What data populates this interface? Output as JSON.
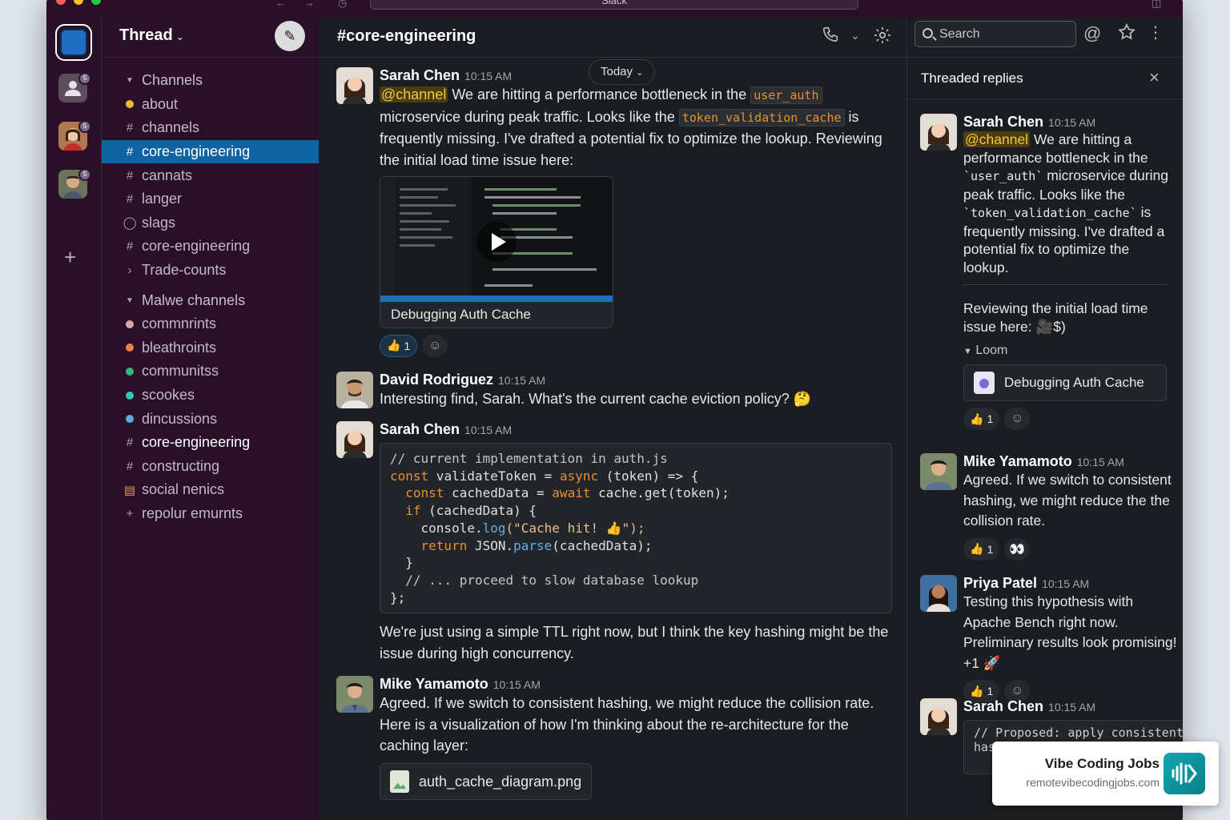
{
  "window": {
    "title": "Slack",
    "traffic_colors": [
      "#ff5f57",
      "#febc2e",
      "#28c840"
    ]
  },
  "rail": {
    "badges": [
      "5",
      "5",
      "5"
    ],
    "add_label": "+"
  },
  "sidebar": {
    "title": "Thread",
    "items": [
      {
        "label": "Channels",
        "type": "section"
      },
      {
        "label": "about",
        "type": "dot",
        "color": "#f2b534"
      },
      {
        "label": "channels",
        "type": "hash"
      },
      {
        "label": "core-engineering",
        "type": "hash",
        "active": true
      },
      {
        "label": "cannats",
        "type": "hash"
      },
      {
        "label": "langer",
        "type": "hash"
      },
      {
        "label": "slags",
        "type": "tag"
      },
      {
        "label": "core-engineering",
        "type": "hash"
      },
      {
        "label": "Trade-counts",
        "type": "chevron"
      }
    ],
    "items2": [
      {
        "label": "Malwe channels",
        "type": "section"
      },
      {
        "label": "commnrints",
        "type": "dot",
        "color": "#d9a6a6"
      },
      {
        "label": "bleathroints",
        "type": "dot",
        "color": "#e8834a"
      },
      {
        "label": "communitss",
        "type": "dot",
        "color": "#2eb67d"
      },
      {
        "label": "scookes",
        "type": "dot",
        "color": "#36c5b0"
      },
      {
        "label": "dincussions",
        "type": "dot",
        "color": "#5fa8e0"
      },
      {
        "label": "core-engineering",
        "type": "hash",
        "bright": true
      },
      {
        "label": "constructing",
        "type": "hash"
      },
      {
        "label": "social nenics",
        "type": "list"
      },
      {
        "label": "repolur emurnts",
        "type": "plus"
      }
    ]
  },
  "main": {
    "channel_title": "#core-engineering",
    "today_label": "Today",
    "messages": {
      "m1": {
        "name": "Sarah Chen",
        "time": "10:15 AM",
        "mention": "@channel",
        "t1": " We are hitting a performance bottleneck in the ",
        "code1": "user_auth",
        "t2": " microservice during peak traffic. Looks like the ",
        "code2": "token_validation_cache",
        "t3": " is frequently missing. I've drafted a potential fix to optimize the lookup. Reviewing the initial load time issue here:",
        "video_caption": "Debugging Auth Cache",
        "reaction_count": "1"
      },
      "m2": {
        "name": "David Rodriguez",
        "time": "10:15 AM",
        "text": "Interesting find, Sarah. What's the current cache eviction policy? 🤔"
      },
      "m3": {
        "name": "Sarah Chen",
        "time": "10:15 AM",
        "code": {
          "l1": "// current implementation in auth.js",
          "l2a": "const",
          "l2b": " validateToken = ",
          "l2c": "async",
          "l2d": " (token) => {",
          "l3a": "  const",
          "l3b": " cachedData = ",
          "l3c": "await",
          "l3d": " cache.get(token);",
          "l4a": "  if",
          "l4b": " (cachedData) {",
          "l5a": "    console.",
          "l5b": "log",
          "l5c": "(\"Cache hit! 👍\");",
          "l6a": "    return",
          "l6b": " JSON.",
          "l6c": "parse",
          "l6d": "(cachedData);",
          "l7": "  }",
          "l8": "  // ... proceed to slow database lookup",
          "l9": "};"
        },
        "after": "We're just using a simple TTL right now, but I think the key hashing might be the issue during high concurrency."
      },
      "m4": {
        "name": "Mike Yamamoto",
        "time": "10:15 AM",
        "text": "Agreed. If we switch to consistent hashing, we might reduce the collision rate. Here is a visualization of how I'm thinking about the re-architecture for the caching layer:",
        "file": "auth_cache_diagram.png"
      }
    }
  },
  "thread": {
    "search_placeholder": "Search",
    "title": "Threaded replies",
    "t1": {
      "name": "Sarah Chen",
      "time": "10:15 AM",
      "mention": "@channel",
      "a": " We are hitting a performance bottleneck in the ",
      "code1": "`user_auth`",
      "b": " microservice during peak traffic. Looks like the ",
      "code2": "`token_validation_cache`",
      "c": " is frequently missing. I've drafted a potential fix to optimize the lookup.",
      "review": "Reviewing the initial load time issue here: 🎥$)",
      "loom_label": "Loom",
      "loom_title": "Debugging Auth Cache",
      "reaction_count": "1"
    },
    "t2": {
      "name": "Mike Yamamoto",
      "time": "10:15 AM",
      "text": "Agreed. If we switch to consistent hashing, we might reduce the the collision rate.",
      "reaction_count": "1"
    },
    "t3": {
      "name": "Priya Patel",
      "time": "10:15 AM",
      "text": "Testing this hypothesis with Apache Bench right now. Preliminary results look promising! +1 🚀",
      "reaction_count": "1"
    },
    "t4": {
      "name": "Sarah Chen",
      "time": "10:15 AM",
      "code": "// Proposed: apply consistent has"
    }
  },
  "promo": {
    "title": "Vibe Coding Jobs",
    "url": "remotevibecodingjobs.com"
  }
}
